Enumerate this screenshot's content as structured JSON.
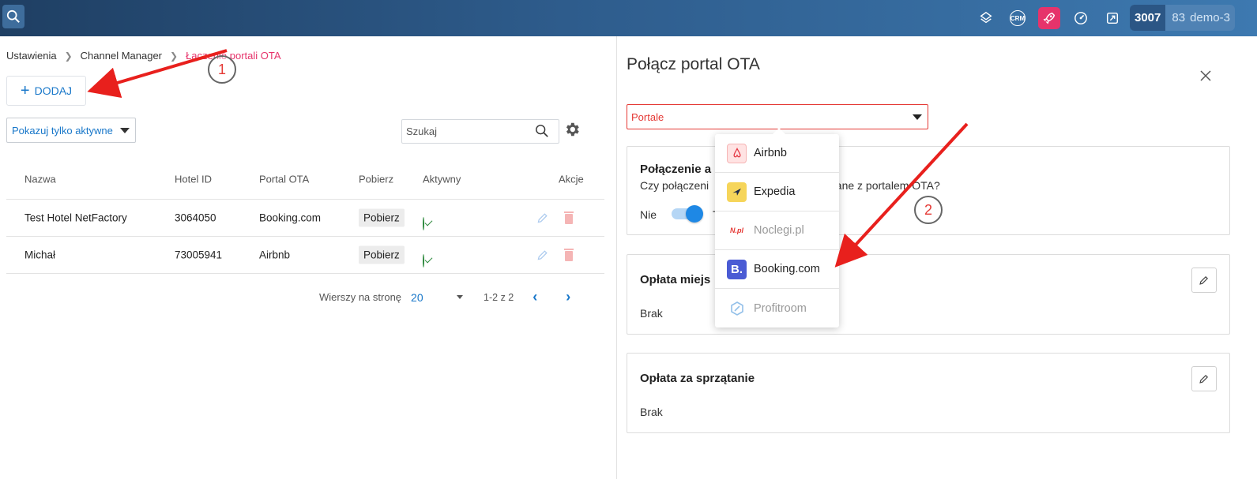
{
  "topbar": {
    "icons": [
      "search-icon",
      "layers-icon",
      "crm-icon",
      "rocket-icon",
      "dashboard-icon",
      "external-icon"
    ],
    "crm_label": "CRM",
    "badge_number": "3007",
    "badge_count": "83",
    "user": "demo-3",
    "colors": {
      "accent": "#1877c9",
      "rocket": "#e6336b",
      "error": "#e53935"
    }
  },
  "breadcrumb": {
    "items": [
      "Ustawienia",
      "Channel Manager"
    ],
    "current": "Łączenie portali OTA"
  },
  "left": {
    "add_label": "DODAJ",
    "filter_label": "Pokazuj tylko aktywne",
    "search_placeholder": "Szukaj"
  },
  "table": {
    "headers": {
      "name": "Nazwa",
      "hotel_id": "Hotel ID",
      "portal": "Portal OTA",
      "download": "Pobierz",
      "active": "Aktywny",
      "actions": "Akcje"
    },
    "rows": [
      {
        "name": "Test Hotel NetFactory",
        "hotel_id": "3064050",
        "portal": "Booking.com",
        "download": "Pobierz",
        "active": true
      },
      {
        "name": "Michał",
        "hotel_id": "73005941",
        "portal": "Airbnb",
        "download": "Pobierz",
        "active": true
      }
    ]
  },
  "pager": {
    "rows_label": "Wierszy na stronę",
    "rows_value": "20",
    "range": "1-2 z 2"
  },
  "panel": {
    "title": "Połącz portal OTA",
    "select_placeholder": "Portale",
    "card1": {
      "title": "Połączenie a",
      "question_start": "Czy połączeni",
      "question_end": "dane z portalem OTA?",
      "toggle_off": "Nie",
      "toggle_on": "T",
      "toggle_state": true
    },
    "card2": {
      "title": "Opłata miejs",
      "value": "Brak"
    },
    "card3": {
      "title": "Opłata za sprzątanie",
      "value": "Brak"
    }
  },
  "dropdown": {
    "items": [
      {
        "label": "Airbnb",
        "icon": "airbnb-logo",
        "disabled": false
      },
      {
        "label": "Expedia",
        "icon": "expedia-logo",
        "disabled": false
      },
      {
        "label": "Noclegi.pl",
        "icon": "noclegi-logo",
        "logo_text": "N.pl",
        "disabled": true
      },
      {
        "label": "Booking.com",
        "icon": "booking-logo",
        "logo_text": "B.",
        "disabled": false
      },
      {
        "label": "Profitroom",
        "icon": "profitroom-logo",
        "disabled": true
      }
    ]
  },
  "annotations": {
    "marker_1": "1",
    "marker_2": "2"
  }
}
